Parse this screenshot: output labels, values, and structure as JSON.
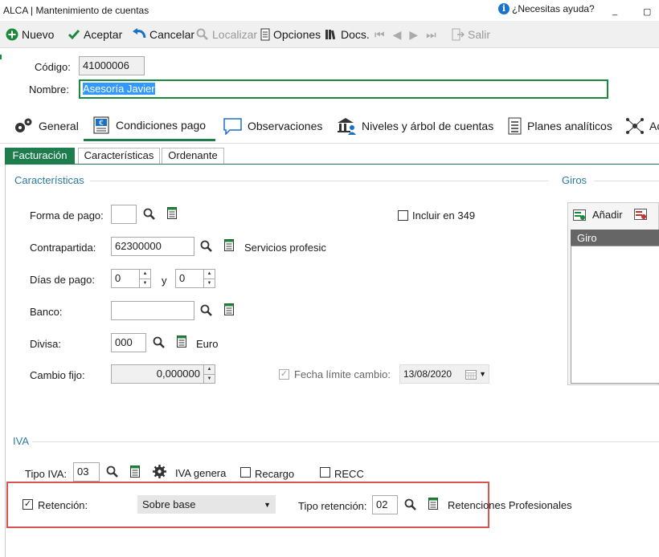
{
  "window": {
    "title": "ALCA | Mantenimiento de cuentas",
    "help": "¿Necesitas ayuda?",
    "min": "_",
    "max": "▢"
  },
  "toolbar": {
    "nuevo": "Nuevo",
    "aceptar": "Aceptar",
    "cancelar": "Cancelar",
    "localizar": "Localizar",
    "opciones": "Opciones",
    "docs": "Docs.",
    "salir": "Salir"
  },
  "header": {
    "codigo_label": "Código:",
    "codigo_value": "41000006",
    "nombre_label": "Nombre:",
    "nombre_value": "Asesoría Javier"
  },
  "module_tabs": [
    {
      "label": "General",
      "icon": "gears-icon"
    },
    {
      "label": "Condiciones pago",
      "icon": "euro-doc-icon"
    },
    {
      "label": "Observaciones",
      "icon": "speech-bubble-icon"
    },
    {
      "label": "Niveles y árbol de cuentas",
      "icon": "bank-user-icon"
    },
    {
      "label": "Planes analíticos",
      "icon": "list-doc-icon"
    },
    {
      "label": "Ac",
      "icon": "network-icon"
    }
  ],
  "sub_tabs": [
    "Facturación",
    "Características",
    "Ordenante"
  ],
  "caracteristicas": {
    "title": "Características",
    "forma_pago_label": "Forma de pago:",
    "forma_pago_value": "",
    "incluir_349_label": "Incluir en 349",
    "contrapartida_label": "Contrapartida:",
    "contrapartida_value": "62300000",
    "contrapartida_desc": "Servicios profesic",
    "dias_pago_label": "Días de pago:",
    "dias_pago_1": "0",
    "dias_y": "y",
    "dias_pago_2": "0",
    "banco_label": "Banco:",
    "banco_value": "",
    "divisa_label": "Divisa:",
    "divisa_value": "000",
    "divisa_desc": "Euro",
    "cambio_label": "Cambio fijo:",
    "cambio_value": "0,000000",
    "fecha_label": "Fecha límite cambio:",
    "fecha_value": "13/08/2020"
  },
  "giros": {
    "title": "Giros",
    "add": "Añadir",
    "col": "Giro"
  },
  "iva": {
    "title": "IVA",
    "tipo_iva_label": "Tipo IVA:",
    "tipo_iva_value": "03",
    "iva_general": "IVA genera",
    "recargo_label": "Recargo",
    "recc_label": "RECC",
    "retencion_label": "Retención:",
    "retencion_checked": "✓",
    "retencion_select": "Sobre base",
    "tipo_ret_label": "Tipo retención:",
    "tipo_ret_value": "02",
    "tipo_ret_desc": "Retenciones Profesionales"
  },
  "colors": {
    "accent": "#1a8a3a",
    "tab_active": "#1e7d4c",
    "highlight": "#d9534f",
    "selection": "#3399ff"
  }
}
